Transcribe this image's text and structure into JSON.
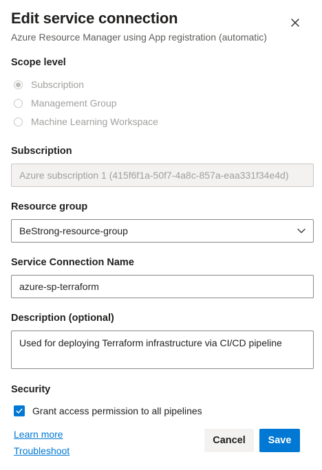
{
  "dialog": {
    "title": "Edit service connection",
    "subtitle": "Azure Resource Manager using App registration (automatic)",
    "close_icon": "close-icon"
  },
  "scope": {
    "label": "Scope level",
    "options": [
      {
        "label": "Subscription",
        "selected": true
      },
      {
        "label": "Management Group",
        "selected": false
      },
      {
        "label": "Machine Learning Workspace",
        "selected": false
      }
    ]
  },
  "subscription": {
    "label": "Subscription",
    "value": "Azure subscription 1 (415f6f1a-50f7-4a8c-857a-eaa331f34e4d)"
  },
  "resource_group": {
    "label": "Resource group",
    "value": "BeStrong-resource-group",
    "icon": "chevron-down-icon"
  },
  "connection_name": {
    "label": "Service Connection Name",
    "value": "azure-sp-terraform"
  },
  "description": {
    "label": "Description (optional)",
    "value": "Used for deploying Terraform infrastructure via CI/CD pipeline"
  },
  "security": {
    "label": "Security",
    "grant_access_label": "Grant access permission to all pipelines",
    "grant_access_checked": true
  },
  "links": {
    "learn_more": "Learn more",
    "troubleshoot": "Troubleshoot"
  },
  "buttons": {
    "cancel": "Cancel",
    "save": "Save"
  },
  "colors": {
    "accent": "#0078d4",
    "disabled_text": "#a19f9d",
    "secondary_text": "#605e5c"
  }
}
